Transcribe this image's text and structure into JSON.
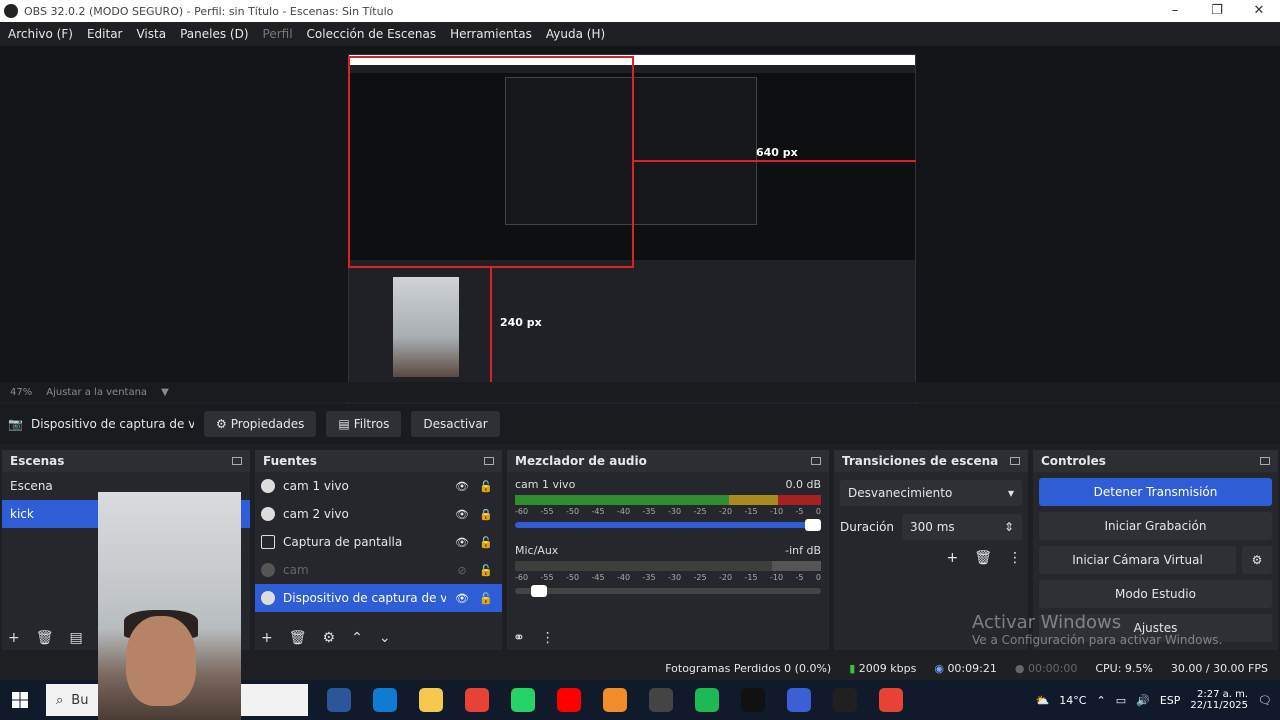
{
  "window": {
    "title": "OBS 32.0.2 (MODO SEGURO) - Perfil: sin Título - Escenas: Sin Título"
  },
  "menu": [
    "Archivo (F)",
    "Editar",
    "Vista",
    "Paneles (D)",
    "Perfil",
    "Colección de Escenas",
    "Herramientas",
    "Ayuda (H)"
  ],
  "preview": {
    "label_width": "640 px",
    "label_height": "240 px"
  },
  "zoom": {
    "value": "47%",
    "mode": "Ajustar a la ventana"
  },
  "source_toolbar": {
    "selected_source": "Dispositivo de captura de v",
    "properties": "Propiedades",
    "filters": "Filtros",
    "deactivate": "Desactivar"
  },
  "scenes": {
    "title": "Escenas",
    "items": [
      {
        "label": "Escena",
        "selected": false
      },
      {
        "label": "kick",
        "selected": true
      }
    ]
  },
  "sources": {
    "title": "Fuentes",
    "items": [
      {
        "label": "cam 1 vivo",
        "icon": "camera-icon",
        "visible": true,
        "locked": false,
        "dim": false,
        "selected": false
      },
      {
        "label": "cam 2 vivo",
        "icon": "camera-icon",
        "visible": true,
        "locked": true,
        "dim": false,
        "selected": false
      },
      {
        "label": "Captura de pantalla",
        "icon": "monitor-icon",
        "visible": true,
        "locked": false,
        "dim": false,
        "selected": false
      },
      {
        "label": "cam",
        "icon": "camera-icon",
        "visible": false,
        "locked": false,
        "dim": true,
        "selected": false
      },
      {
        "label": "Dispositivo de captura de vid",
        "icon": "camera-icon",
        "visible": true,
        "locked": false,
        "dim": false,
        "selected": true
      }
    ]
  },
  "mixer": {
    "title": "Mezclador de audio",
    "channels": [
      {
        "name": "cam 1 vivo",
        "level": "0.0 dB",
        "fader": 1.0,
        "muted": false
      },
      {
        "name": "Mic/Aux",
        "level": "-inf dB",
        "fader": 0.02,
        "muted": true
      }
    ],
    "ticks": [
      "-60",
      "-55",
      "-50",
      "-45",
      "-40",
      "-35",
      "-30",
      "-25",
      "-20",
      "-15",
      "-10",
      "-5",
      "0"
    ]
  },
  "transitions": {
    "title": "Transiciones de escena",
    "type": "Desvanecimiento",
    "duration_label": "Duración",
    "duration_value": "300 ms"
  },
  "controls": {
    "title": "Controles",
    "buttons": [
      "Detener Transmisión",
      "Iniciar Grabación",
      "Iniciar Cámara Virtual",
      "Modo Estudio",
      "Ajustes"
    ]
  },
  "status": {
    "dropped": "Fotogramas Perdidos 0 (0.0%)",
    "bitrate": "2009 kbps",
    "live_time": "00:09:21",
    "rec_time": "00:00:00",
    "cpu": "CPU: 9.5%",
    "fps": "30.00 / 30.00 FPS"
  },
  "watermark": {
    "line1": "Activar Windows",
    "line2": "Ve a Configuración para activar Windows."
  },
  "taskbar": {
    "search_text": "Bu",
    "weather": "14°C",
    "lang": "ESP",
    "time": "2:27 a. m.",
    "date": "22/11/2025",
    "app_colors": [
      "#2b579a",
      "#0f7bd3",
      "#f2c94c",
      "#e84235",
      "#25d366",
      "#ff0000",
      "#f08c2a",
      "#444444",
      "#1db954",
      "#111111",
      "#3a5fd6",
      "#202020",
      "#e84235"
    ]
  }
}
